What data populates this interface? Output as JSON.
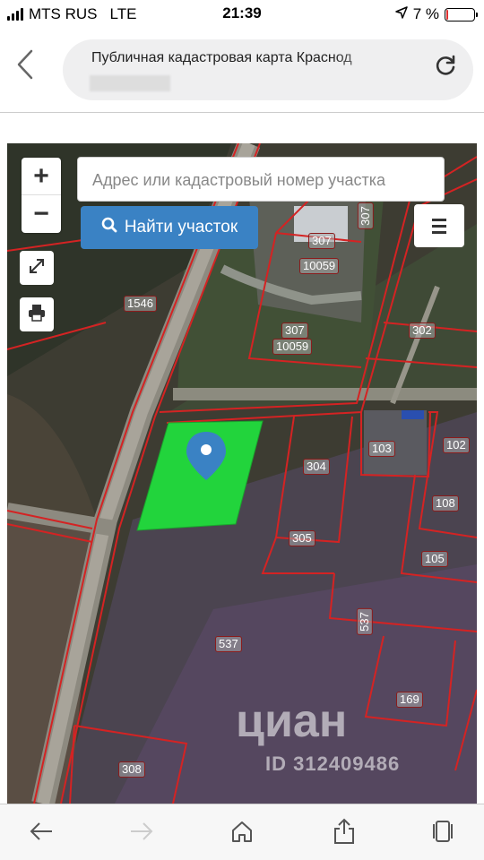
{
  "status_bar": {
    "carrier": "MTS RUS",
    "network": "LTE",
    "time": "21:39",
    "battery_percent": "7 %",
    "battery_level": 0.07,
    "battery_color": "#e03030"
  },
  "browser": {
    "page_title": "Публичная кадастровая карта Краснод",
    "back_icon": "chevron-left-icon",
    "reload_icon": "reload-icon"
  },
  "map": {
    "zoom_in_label": "+",
    "zoom_out_label": "−",
    "search_placeholder": "Адрес или кадастровый номер участка",
    "find_button_label": "Найти участок",
    "find_button_color": "#3a82c4",
    "selected_parcel_color": "#22d43c",
    "parcels": [
      {
        "id": "p1546",
        "label": "1546"
      },
      {
        "id": "p307a",
        "label": "307"
      },
      {
        "id": "p10059a",
        "label": "10059"
      },
      {
        "id": "p307b",
        "label": "307"
      },
      {
        "id": "p10059b",
        "label": "10059"
      },
      {
        "id": "p307c",
        "label": "307"
      },
      {
        "id": "p302",
        "label": "302"
      },
      {
        "id": "p304",
        "label": "304"
      },
      {
        "id": "p103",
        "label": "103"
      },
      {
        "id": "p102",
        "label": "102"
      },
      {
        "id": "p108",
        "label": "108"
      },
      {
        "id": "p305",
        "label": "305"
      },
      {
        "id": "p105",
        "label": "105"
      },
      {
        "id": "p537a",
        "label": "537"
      },
      {
        "id": "p537b",
        "label": "537"
      },
      {
        "id": "p169",
        "label": "169"
      },
      {
        "id": "p308",
        "label": "308"
      }
    ],
    "watermark_brand": "циан",
    "watermark_id": "ID 312409486"
  },
  "toolbar": {
    "back_icon": "arrow-left-icon",
    "forward_icon": "arrow-right-icon",
    "home_icon": "home-icon",
    "share_icon": "share-icon",
    "tabs_icon": "tabs-icon"
  }
}
